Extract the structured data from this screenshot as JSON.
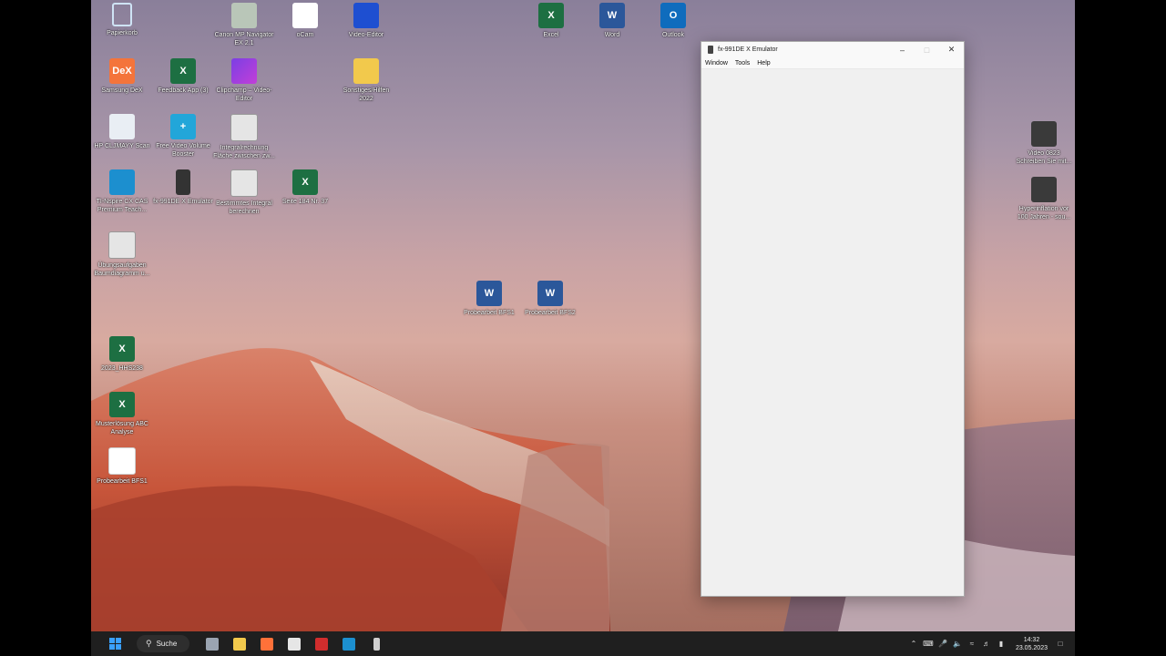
{
  "desktop": {
    "icons": [
      {
        "label": "Papierkorb",
        "glyph": "",
        "kind": "bin"
      },
      {
        "label": "Canon MP Navigator EX 2.1",
        "glyph": "",
        "kind": "canon"
      },
      {
        "label": "oCam",
        "glyph": "o",
        "kind": "ocam"
      },
      {
        "label": "Video-Editor",
        "glyph": "",
        "kind": "video"
      },
      {
        "label": "Excel",
        "glyph": "X",
        "kind": "excel"
      },
      {
        "label": "Word",
        "glyph": "W",
        "kind": "word"
      },
      {
        "label": "Outlook",
        "glyph": "O",
        "kind": "outlook"
      },
      {
        "label": "Samsung DeX",
        "glyph": "DeX",
        "kind": "dex"
      },
      {
        "label": "Feedback App (3)",
        "glyph": "X",
        "kind": "excel"
      },
      {
        "label": "Clipchamp – Video-Editor",
        "glyph": "",
        "kind": "clip"
      },
      {
        "label": "Sonstiges/Hilfen 2022",
        "glyph": "",
        "kind": "folder"
      },
      {
        "label": "HP CLJMAYY Scan",
        "glyph": "",
        "kind": "hp"
      },
      {
        "label": "Free Video Volume Booster",
        "glyph": "+",
        "kind": "free"
      },
      {
        "label": "Integralrechnung Fläche zwischen zw...",
        "glyph": "",
        "kind": "film"
      },
      {
        "label": "Video 0823 Schreiben Sie mit...",
        "glyph": "",
        "kind": "filmdark"
      },
      {
        "label": "TI-Nspire CX CAS Premium Teach...",
        "glyph": "",
        "kind": "ti"
      },
      {
        "label": "fx-991DE X Emulator",
        "glyph": "",
        "kind": "calc"
      },
      {
        "label": "Bestimmtes Integral berechnen",
        "glyph": "",
        "kind": "film"
      },
      {
        "label": "Seite 184 Nr. 37",
        "glyph": "X",
        "kind": "excel"
      },
      {
        "label": "Hyperinflation vor 100 Jahren - sou...",
        "glyph": "",
        "kind": "filmdark"
      },
      {
        "label": "Übungsaufgaben Baumdiagramm u...",
        "glyph": "",
        "kind": "film"
      },
      {
        "label": "Probearbeit BFS1",
        "glyph": "W",
        "kind": "word"
      },
      {
        "label": "Probearbeit BFS2",
        "glyph": "W",
        "kind": "word"
      },
      {
        "label": "2023_HHS238",
        "glyph": "X",
        "kind": "excel"
      },
      {
        "label": "Musterlösung ABC Analyse",
        "glyph": "X",
        "kind": "excel"
      },
      {
        "label": "Probearbeit BFS1",
        "glyph": "PDF",
        "kind": "pdf"
      }
    ]
  },
  "window": {
    "title": "fx-991DE X Emulator",
    "minimize": "–",
    "maximize": "□",
    "close": "✕",
    "menu": [
      "Window",
      "Tools",
      "Help"
    ]
  },
  "taskbar": {
    "search_label": "Suche",
    "apps": [
      {
        "name": "task-view",
        "color": "#9aa4b1"
      },
      {
        "name": "file-explorer",
        "color": "#f2c94c"
      },
      {
        "name": "firefox",
        "color": "#ff7139"
      },
      {
        "name": "photo-app",
        "color": "#e6e6e6"
      },
      {
        "name": "acrobat",
        "color": "#d12d2d"
      },
      {
        "name": "ti-nspire",
        "color": "#1c8fcf"
      },
      {
        "name": "fx-emulator",
        "color": "#cfcfcf"
      }
    ],
    "clock_time": "14:32",
    "clock_date": "23.05.2023"
  }
}
